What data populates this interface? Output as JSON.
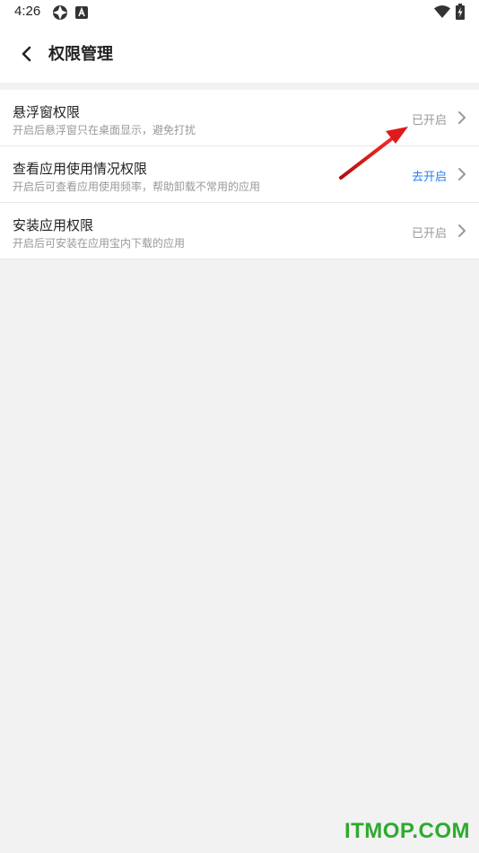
{
  "status_bar": {
    "time": "4:26",
    "icons": [
      "settings-app-icon",
      "accessibility-app-icon",
      "wifi-icon",
      "battery-icon"
    ]
  },
  "app_bar": {
    "title": "权限管理",
    "back_icon": "chevron-left-icon"
  },
  "permissions": [
    {
      "title": "悬浮窗权限",
      "desc": "开启后悬浮窗只在桌面显示，避免打扰",
      "status": "已开启",
      "enabled": true
    },
    {
      "title": "查看应用使用情况权限",
      "desc": "开启后可查看应用使用频率，帮助卸载不常用的应用",
      "status": "去开启",
      "enabled": false
    },
    {
      "title": "安装应用权限",
      "desc": "开启后可安装在应用宝内下载的应用",
      "status": "已开启",
      "enabled": true
    }
  ],
  "colors": {
    "accent_blue": "#2a7ff0",
    "muted_gray": "#999999",
    "annotation_red": "#e0191b",
    "watermark_green": "#2eaa2e"
  },
  "watermark": "ITMOP.COM"
}
